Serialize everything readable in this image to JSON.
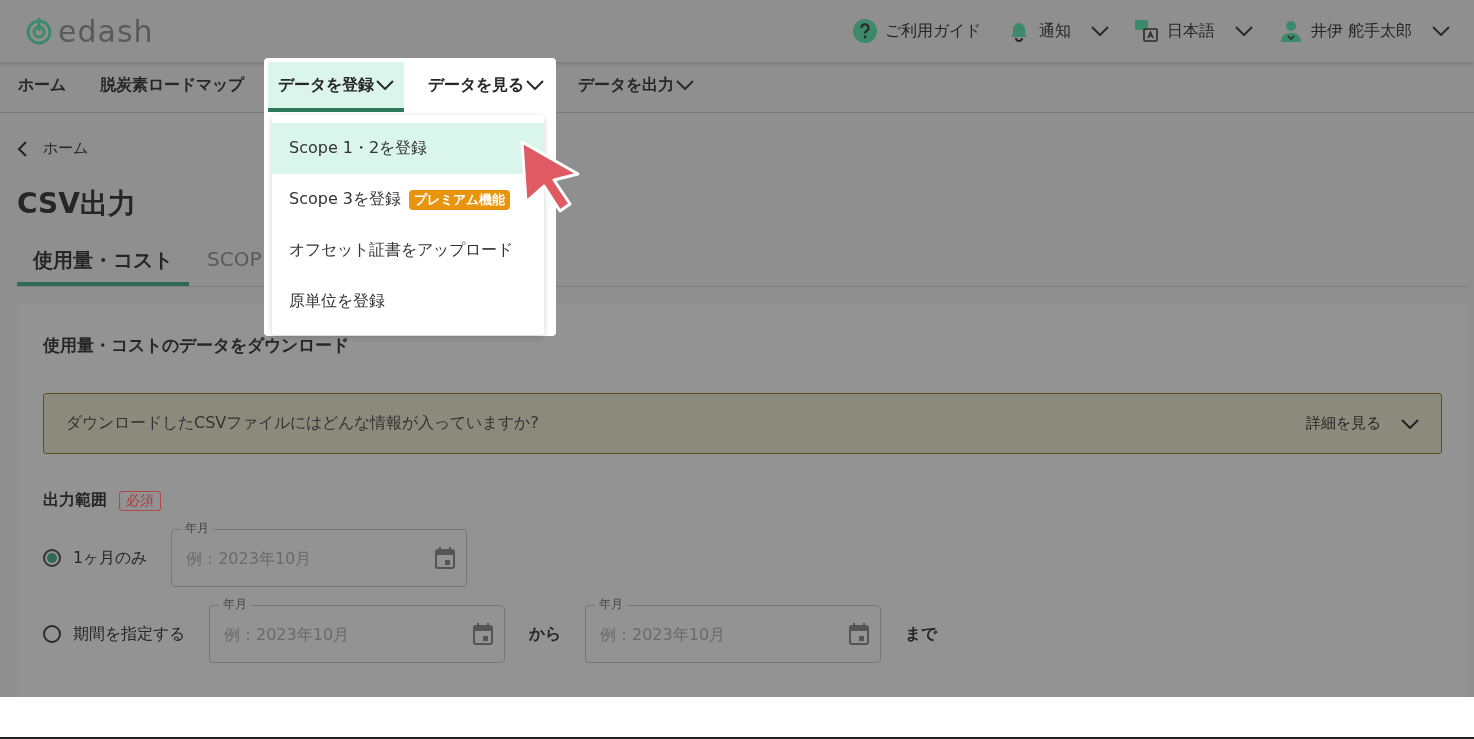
{
  "header": {
    "logo": "edash",
    "actions": [
      {
        "kind": "help",
        "label": "ご利用ガイド",
        "dropdown": false
      },
      {
        "kind": "bell",
        "label": "通知",
        "dropdown": true
      },
      {
        "kind": "language",
        "label": "日本語",
        "dropdown": true
      },
      {
        "kind": "user",
        "label": "井伊 舵手太郎",
        "dropdown": true
      }
    ]
  },
  "nav": [
    {
      "label": "ホーム",
      "selected": false,
      "dropdown": false
    },
    {
      "label": "脱炭素ロードマップ",
      "selected": false,
      "dropdown": false
    },
    {
      "label": "データを登録",
      "selected": true,
      "dropdown": true
    },
    {
      "label": "データを見る",
      "selected": false,
      "dropdown": true
    },
    {
      "label": "データを出力",
      "selected": false,
      "dropdown": true
    }
  ],
  "dropdown_menu": {
    "items": [
      {
        "label": "Scope 1・2を登録",
        "selected": true
      },
      {
        "label": "Scope 3を登録",
        "selected": false,
        "badge": "プレミアム機能"
      },
      {
        "label": "オフセット証書をアップロード",
        "selected": false
      },
      {
        "label": "原単位を登録",
        "selected": false
      }
    ]
  },
  "breadcrumb": "ホーム",
  "title": "CSV出力",
  "tabs": [
    {
      "label": "使用量・コスト",
      "selected": true
    },
    {
      "label": "SCOP",
      "selected": false
    }
  ],
  "card": {
    "title": "使用量・コストのデータをダウンロード",
    "info": {
      "text": "ダウンロードしたCSVファイルにはどんな情報が入っていますか?",
      "toggle": "詳細を見る"
    },
    "range": {
      "label": "出力範囲",
      "required_badge": "必須",
      "options": [
        {
          "label": "1ヶ月のみ",
          "selected": true,
          "parts": [
            {
              "kind": "field",
              "label": "年月",
              "placeholder": "例：2023年10月"
            }
          ]
        },
        {
          "label": "期間を指定する",
          "selected": false,
          "parts": [
            {
              "kind": "field",
              "label": "年月",
              "placeholder": "例：2023年10月"
            },
            {
              "kind": "text",
              "text": "から"
            },
            {
              "kind": "field",
              "label": "年月",
              "placeholder": "例：2023年10月"
            },
            {
              "kind": "text",
              "text": "まで"
            }
          ]
        }
      ]
    }
  }
}
